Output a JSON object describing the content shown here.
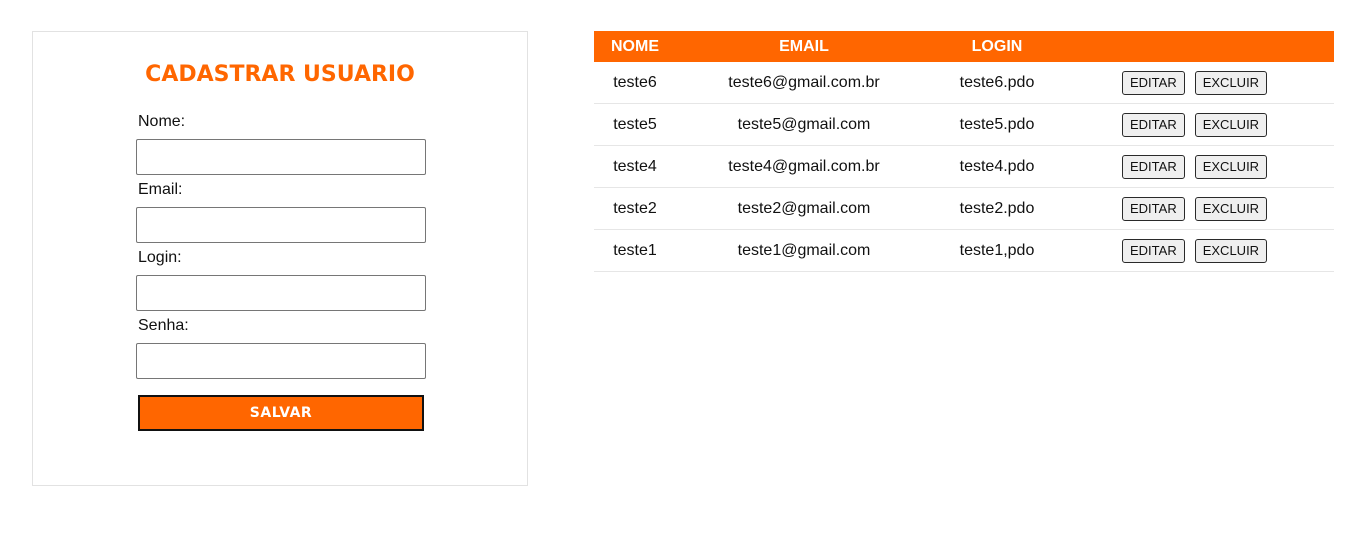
{
  "form": {
    "title": "CADASTRAR USUARIO",
    "fields": [
      {
        "label": "Nome:",
        "value": "",
        "placeholder": ""
      },
      {
        "label": "Email:",
        "value": "",
        "placeholder": ""
      },
      {
        "label": "Login:",
        "value": "",
        "placeholder": ""
      },
      {
        "label": "Senha:",
        "value": "",
        "placeholder": ""
      }
    ],
    "save_label": "SALVAR"
  },
  "table": {
    "headers": [
      "NOME",
      "EMAIL",
      "LOGIN",
      ""
    ],
    "rows": [
      {
        "nome": "teste6",
        "email": "teste6@gmail.com.br",
        "login": "teste6.pdo"
      },
      {
        "nome": "teste5",
        "email": "teste5@gmail.com",
        "login": "teste5.pdo"
      },
      {
        "nome": "teste4",
        "email": "teste4@gmail.com.br",
        "login": "teste4.pdo"
      },
      {
        "nome": "teste2",
        "email": "teste2@gmail.com",
        "login": "teste2.pdo"
      },
      {
        "nome": "teste1",
        "email": "teste1@gmail.com",
        "login": "teste1,pdo"
      }
    ],
    "edit_label": "EDITAR",
    "delete_label": "EXCLUIR"
  },
  "colors": {
    "accent": "#ff6600",
    "border": "#e2e2e2"
  }
}
